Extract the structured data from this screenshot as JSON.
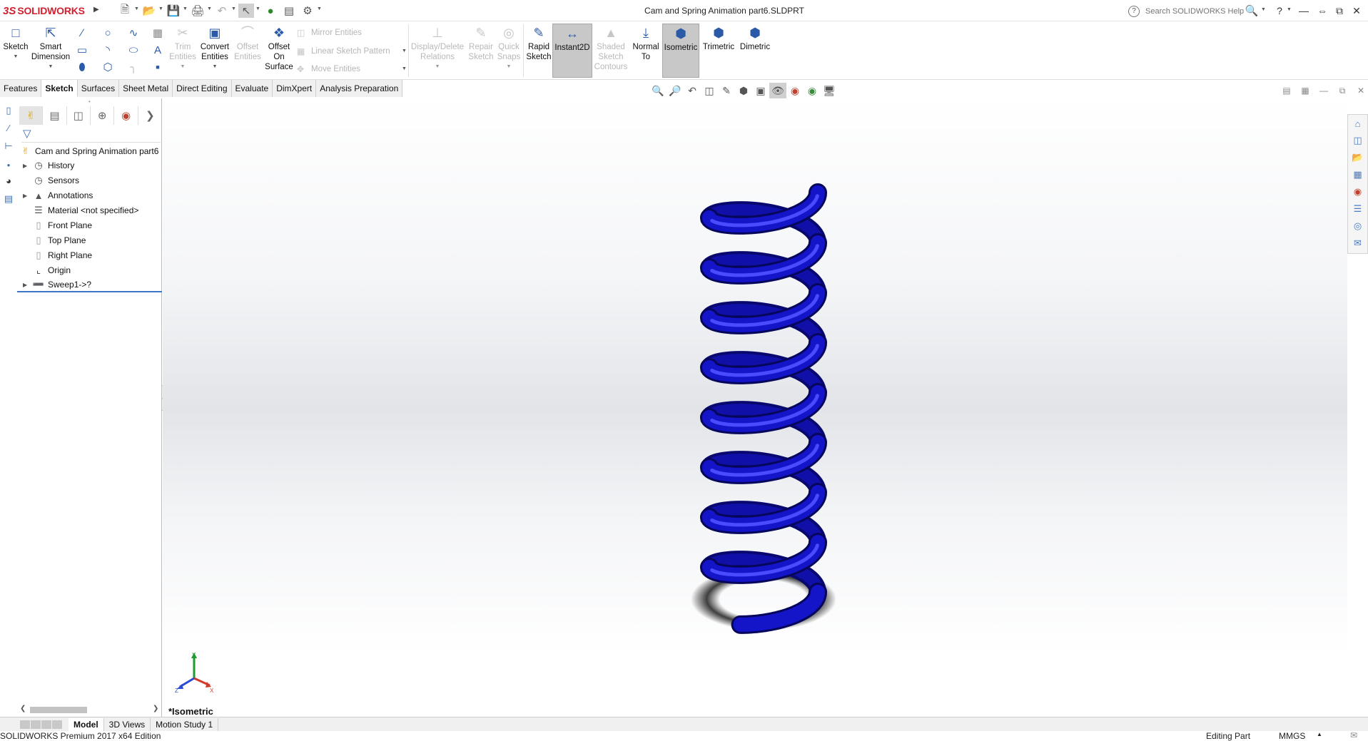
{
  "app": {
    "logo_prefix": "3S",
    "logo_name": "SOLIDWORKS",
    "document_title": "Cam and Spring Animation part6.SLDPRT",
    "search_placeholder": "Search SOLIDWORKS Help"
  },
  "command_manager": {
    "sketch": "Sketch",
    "smart_dimension": [
      "Smart",
      "Dimension"
    ],
    "trim_entities": [
      "Trim",
      "Entities"
    ],
    "convert_entities": [
      "Convert",
      "Entities"
    ],
    "offset_entities": [
      "Offset",
      "Entities"
    ],
    "offset_on_surface": [
      "Offset",
      "On",
      "Surface"
    ],
    "mirror_entities": "Mirror Entities",
    "linear_sketch_pattern": "Linear Sketch Pattern",
    "move_entities": "Move Entities",
    "display_delete_relations": [
      "Display/Delete",
      "Relations"
    ],
    "repair_sketch": [
      "Repair",
      "Sketch"
    ],
    "quick_snaps": [
      "Quick",
      "Snaps"
    ],
    "rapid_sketch": [
      "Rapid",
      "Sketch"
    ],
    "instant2d": "Instant2D",
    "shaded_sketch_contours": [
      "Shaded",
      "Sketch",
      "Contours"
    ],
    "normal_to": [
      "Normal",
      "To"
    ],
    "isometric": "Isometric",
    "trimetric": "Trimetric",
    "dimetric": "Dimetric"
  },
  "tabs": [
    "Features",
    "Sketch",
    "Surfaces",
    "Sheet Metal",
    "Direct Editing",
    "Evaluate",
    "DimXpert",
    "Analysis Preparation"
  ],
  "active_tab": "Sketch",
  "feature_tree": {
    "root": "Cam and Spring Animation part6",
    "items": [
      {
        "label": "History",
        "expandable": true,
        "icon": "history-icon"
      },
      {
        "label": "Sensors",
        "expandable": false,
        "icon": "sensors-icon"
      },
      {
        "label": "Annotations",
        "expandable": true,
        "icon": "annotations-icon"
      },
      {
        "label": "Material <not specified>",
        "expandable": false,
        "icon": "material-icon"
      },
      {
        "label": "Front Plane",
        "expandable": false,
        "icon": "plane-icon"
      },
      {
        "label": "Top Plane",
        "expandable": false,
        "icon": "plane-icon"
      },
      {
        "label": "Right Plane",
        "expandable": false,
        "icon": "plane-icon"
      },
      {
        "label": "Origin",
        "expandable": false,
        "icon": "origin-icon"
      },
      {
        "label": "Sweep1->?",
        "expandable": true,
        "icon": "sweep-icon"
      }
    ]
  },
  "viewport": {
    "view_name": "*Isometric",
    "spring_color": "#1414c8",
    "triad": {
      "x": "X",
      "y": "Y",
      "z": "Z"
    }
  },
  "bottom_tabs": [
    "Model",
    "3D Views",
    "Motion Study 1"
  ],
  "active_bottom_tab": "Model",
  "status": {
    "edition": "SOLIDWORKS Premium 2017 x64 Edition",
    "mode": "Editing Part",
    "units": "MMGS"
  }
}
